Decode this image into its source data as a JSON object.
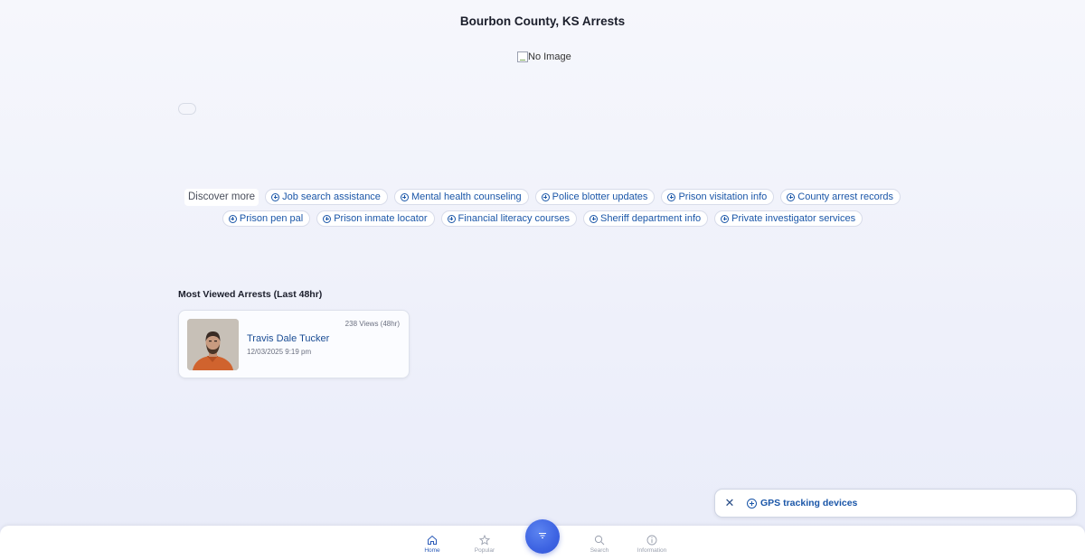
{
  "page": {
    "title": "Bourbon County, KS Arrests",
    "image_alt": "No Image"
  },
  "discover": {
    "label": "Discover more",
    "row1": [
      "Job search assistance",
      "Mental health counseling",
      "Police blotter updates",
      "Prison visitation info",
      "County arrest records"
    ],
    "row2": [
      "Prison pen pal",
      "Prison inmate locator",
      "Financial literacy courses",
      "Sheriff department info",
      "Private investigator services"
    ]
  },
  "most_viewed": {
    "title": "Most Viewed Arrests (Last 48hr)",
    "items": [
      {
        "name": "Travis Dale Tucker",
        "datetime": "12/03/2025 9:19 pm",
        "views": "238 Views (48hr)"
      }
    ]
  },
  "gps_banner": {
    "label": "GPS tracking devices",
    "close_glyph": "✕"
  },
  "nav": {
    "home": "Home",
    "popular": "Popular",
    "search": "Search",
    "information": "Information"
  },
  "colors": {
    "accent": "#1a56a8",
    "fab": "#3d63e2",
    "nav_active": "#2b5bb8"
  }
}
